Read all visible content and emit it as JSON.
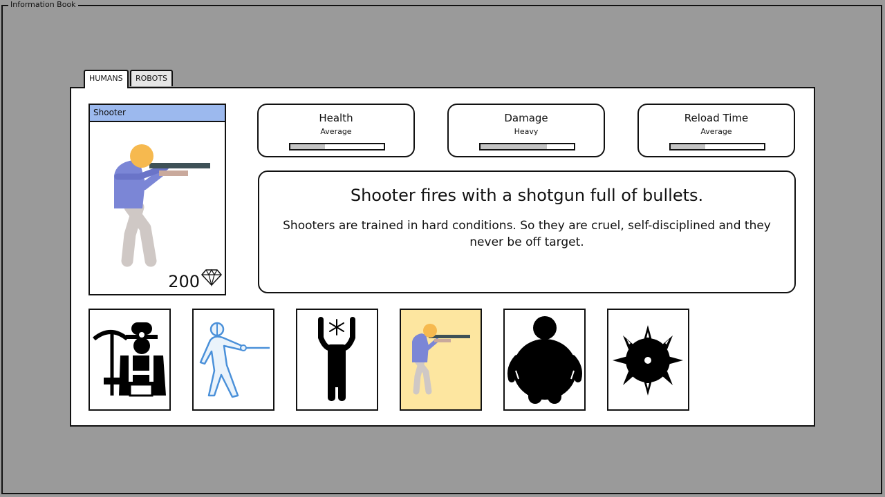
{
  "window": {
    "title": "Information Book"
  },
  "tabs": [
    {
      "label": "HUMANS",
      "active": true
    },
    {
      "label": "ROBOTS",
      "active": false
    }
  ],
  "card": {
    "title": "Shooter",
    "cost": "200",
    "cost_icon": "diamond-icon",
    "title_color": "#9cb9ee"
  },
  "stats": [
    {
      "name": "Health",
      "level": "Average",
      "fill": 0.37
    },
    {
      "name": "Damage",
      "level": "Heavy",
      "fill": 0.71
    },
    {
      "name": "Reload Time",
      "level": "Average",
      "fill": 0.37
    }
  ],
  "description": {
    "headline": "Shooter fires with a shotgun full of bullets.",
    "body": "Shooters are trained in hard conditions. So they are cruel, self-disciplined and they never be off target."
  },
  "units": [
    {
      "icon": "miner-icon",
      "selected": false
    },
    {
      "icon": "fencer-icon",
      "selected": false
    },
    {
      "icon": "frost-man-icon",
      "selected": false
    },
    {
      "icon": "shooter-icon",
      "selected": true
    },
    {
      "icon": "fat-man-icon",
      "selected": false
    },
    {
      "icon": "spiked-mine-icon",
      "selected": false
    }
  ],
  "colors": {
    "background": "#9a9a9a",
    "selected_unit": "#fde6a0",
    "bar_fill": "#c4c4c4"
  }
}
